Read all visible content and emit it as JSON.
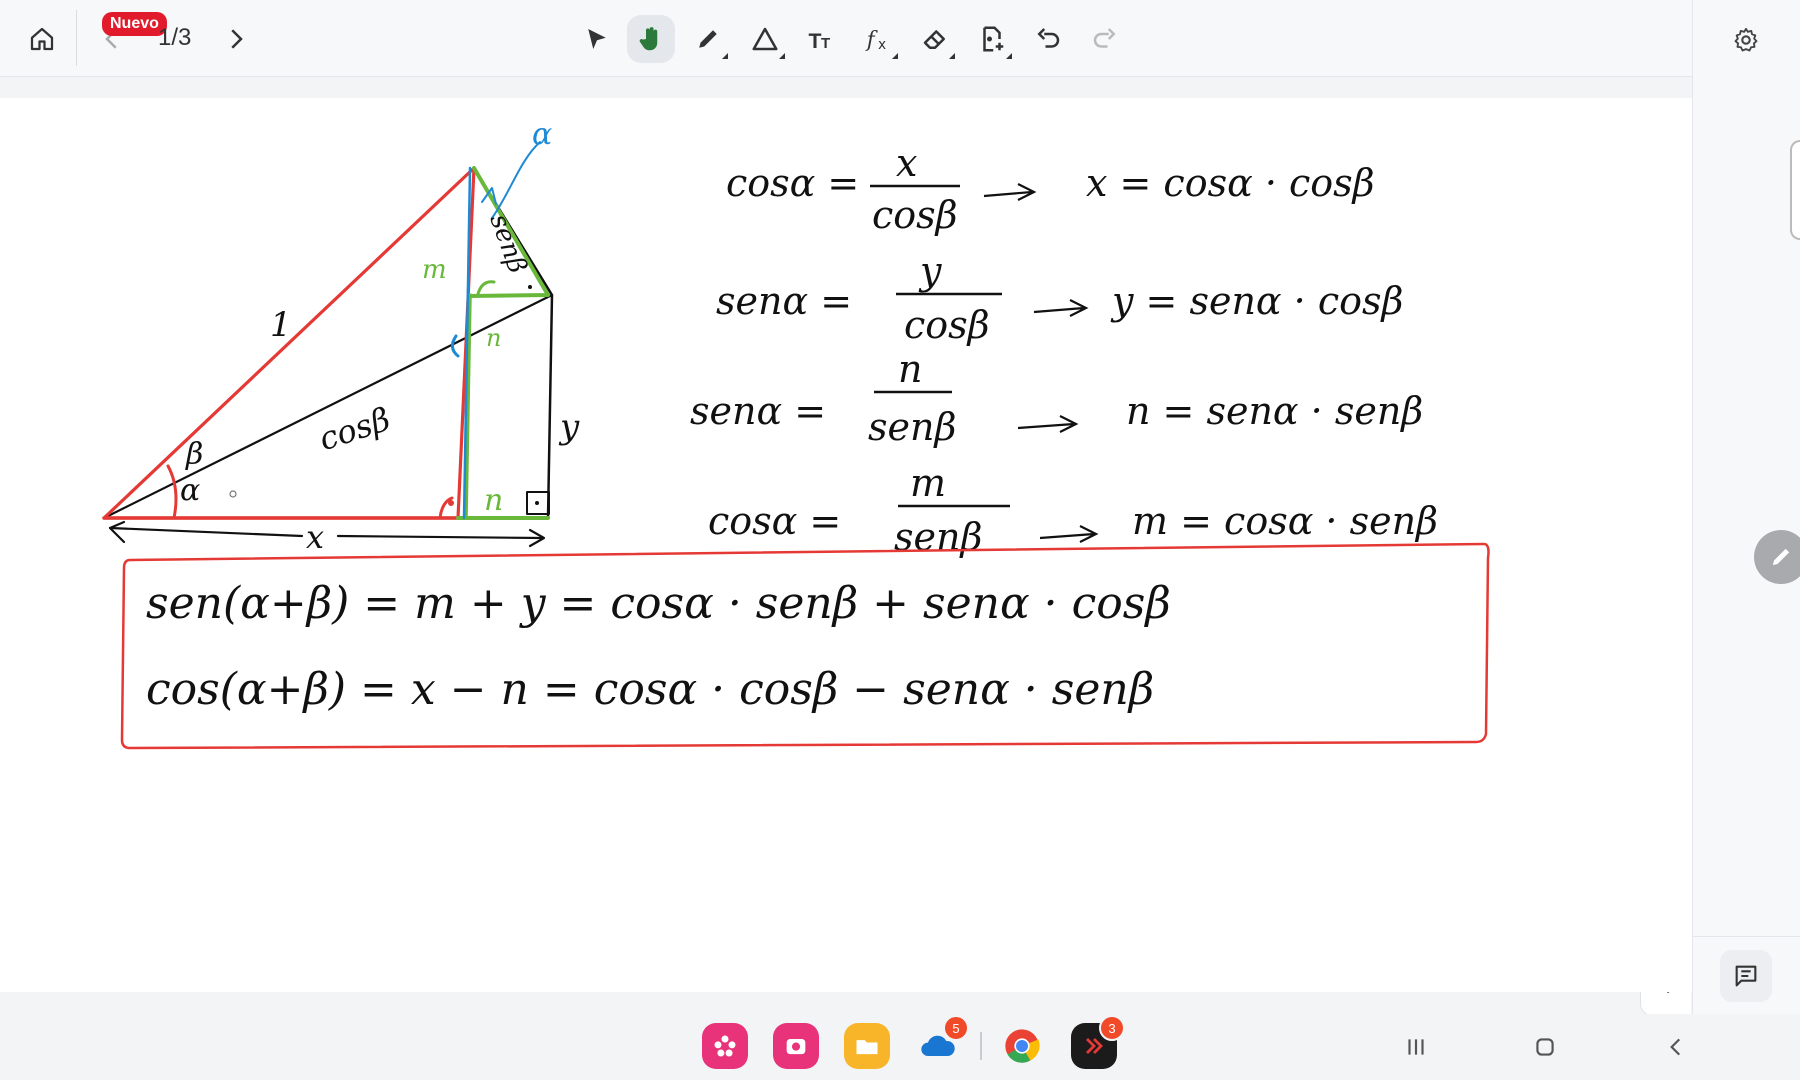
{
  "toolbar": {
    "badge": "Nuevo",
    "page_indicator": "1/3",
    "tools": [
      "home-icon",
      "prev-page-icon",
      "next-page-icon",
      "select-arrow-icon",
      "hand-icon",
      "pen-icon",
      "shape-icon",
      "text-icon",
      "formula-icon",
      "eraser-icon",
      "insert-page-icon",
      "undo-icon",
      "redo-icon"
    ],
    "active_tool": "hand-icon"
  },
  "diagram": {
    "labels": {
      "hyp": "1",
      "cosb": "cosβ",
      "senb": "senβ",
      "m": "m",
      "n": "n",
      "y": "y",
      "x": "x",
      "alpha": "α",
      "beta": "β",
      "alpha_top": "α"
    },
    "colors": {
      "ink": "#111111",
      "red": "#e53935",
      "green": "#6ab83a",
      "blue": "#1e8ad6"
    }
  },
  "equations": [
    {
      "lhs": "cosα =",
      "num": "x",
      "den": "cosβ",
      "rhs": "x = cosα · cosβ"
    },
    {
      "lhs": "senα =",
      "num": "y",
      "den": "cosβ",
      "rhs": "y = senα · cosβ"
    },
    {
      "lhs": "senα =",
      "num": "n",
      "den": "senβ",
      "rhs": "n = senα · senβ"
    },
    {
      "lhs": "cosα =",
      "num": "m",
      "den": "senβ",
      "rhs": "m = cosα · senβ"
    }
  ],
  "summary": {
    "line1": "sen(α+β) = m + y = cosα · senβ + senα · cosβ",
    "line2": "cos(α+β) = x − n = cosα · cosβ − senα · senβ",
    "border_color": "#e53935"
  },
  "taskbar": {
    "apps": [
      {
        "name": "flower-app-icon",
        "color": "#e8327a",
        "badge": ""
      },
      {
        "name": "camera-app-icon",
        "color": "#e8327a",
        "badge": ""
      },
      {
        "name": "folder-app-icon",
        "color": "#f9b52a",
        "badge": ""
      },
      {
        "name": "cloud-app-icon",
        "color": "#1977d2",
        "badge": "5"
      },
      {
        "name": "chrome-icon",
        "color": "#34a853",
        "badge": ""
      },
      {
        "name": "code-app-icon",
        "color": "#1b1b1b",
        "badge": "3"
      }
    ],
    "nav": [
      "recent-apps-icon",
      "home-nav-icon",
      "back-nav-icon"
    ]
  }
}
